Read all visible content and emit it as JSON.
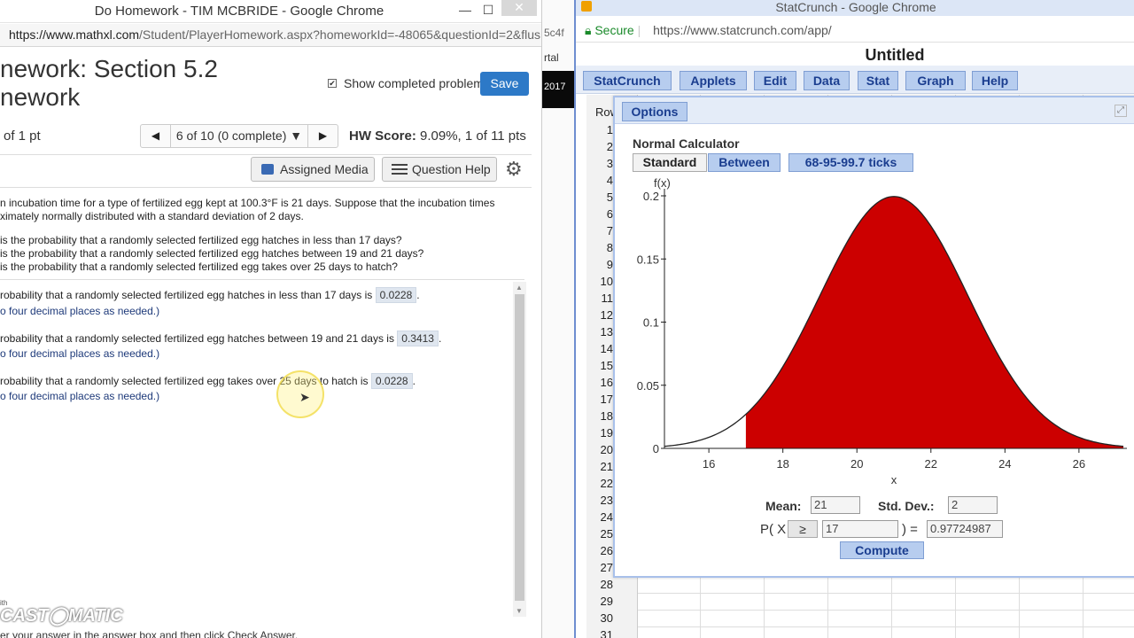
{
  "left_window": {
    "title": "Do Homework - TIM MCBRIDE - Google Chrome",
    "controls": {
      "minimize": "—",
      "maximize": "☐",
      "close": "✕"
    },
    "url_host": "https://www.mathxl.com",
    "url_rest": "/Student/PlayerHomework.aspx?homeworkId=-48065&questionId=2&flus...",
    "hw_title_line1": "nework: Section 5.2",
    "hw_title_line2": "nework",
    "show_completed_label": "Show completed problem",
    "save_label": "Save",
    "points_label": "of 1 pt",
    "nav_prev": "◀",
    "nav_status": "6 of 10 (0 complete) ▼",
    "nav_next": "▶",
    "hw_score_label": "HW Score:",
    "hw_score_value": "9.09%, 1 of 11 pts",
    "assigned_media_label": "Assigned Media",
    "question_help_label": "Question Help",
    "question_line1": "n incubation time for a type of fertilized egg kept at 100.3°F is 21 days. Suppose that the incubation times",
    "question_line2": "ximately normally distributed with a standard deviation of 2 days.",
    "sub_a": "is the probability that a randomly selected fertilized egg hatches in less than 17 days?",
    "sub_b": "is the probability that a randomly selected fertilized egg hatches between 19 and 21 days?",
    "sub_c": "is the probability that a randomly selected fertilized egg takes over 25 days to hatch?",
    "ans_a_text": "robability that a randomly selected fertilized egg hatches in less than 17 days is",
    "ans_a_value": "0.0228",
    "ans_b_text": "robability that a randomly selected fertilized egg hatches between 19 and 21 days is",
    "ans_b_value": "0.3413",
    "ans_c_text": "robability that a randomly selected fertilized egg takes over 25 days to hatch is",
    "ans_c_value": "0.0228",
    "round_note": "o four decimal places as needed.)",
    "watermark": "CAST◯MATIC",
    "watermark_small": "ith",
    "bottom_text": "er your answer in the answer box and then click Check Answer."
  },
  "mid_strip": {
    "url_frag": "5c4f",
    "portal": "rtal",
    "year": "2017"
  },
  "right_window": {
    "title": "StatCrunch - Google Chrome",
    "secure_label": "Secure",
    "url": "https://www.statcrunch.com/app/",
    "doc_title": "Untitled",
    "menu": [
      "StatCrunch",
      "Applets",
      "Edit",
      "Data",
      "Stat",
      "Graph",
      "Help"
    ],
    "row_header": "Row",
    "rows": [
      "1",
      "2",
      "3",
      "4",
      "5",
      "6",
      "7",
      "8",
      "9",
      "10",
      "11",
      "12",
      "13",
      "14",
      "15",
      "16",
      "17",
      "18",
      "19",
      "20",
      "21",
      "22",
      "23",
      "24",
      "25",
      "26",
      "27",
      "28",
      "29",
      "30",
      "31"
    ],
    "options_label": "Options",
    "calculator_title": "Normal Calculator",
    "tab_standard": "Standard",
    "tab_between": "Between",
    "tab_ticks": "68-95-99.7 ticks",
    "mean_label": "Mean:",
    "mean_value": "21",
    "sd_label": "Std. Dev.:",
    "sd_value": "2",
    "p_open": "P(",
    "p_var": "X",
    "operator": "≥",
    "x_value": "17",
    "p_close": ") =",
    "result_value": "0.97724987",
    "compute_label": "Compute"
  },
  "chart_data": {
    "type": "area",
    "title": "",
    "ylabel": "f(x)",
    "xlabel": "x",
    "mean": 21,
    "sd": 2,
    "xlim": [
      14.8,
      27.2
    ],
    "ylim": [
      0,
      0.2
    ],
    "x_ticks": [
      16,
      18,
      20,
      22,
      24,
      26
    ],
    "y_ticks": [
      0,
      0.05,
      0.1,
      0.15,
      0.2
    ],
    "y_tick_labels": [
      "0",
      "0.05",
      "0.1",
      "0.15",
      "0.2"
    ],
    "shade_from": 17,
    "shade_to": 27.2,
    "colors": {
      "shade": "#cc0000",
      "curve": "#222222",
      "axis": "#222222"
    }
  }
}
